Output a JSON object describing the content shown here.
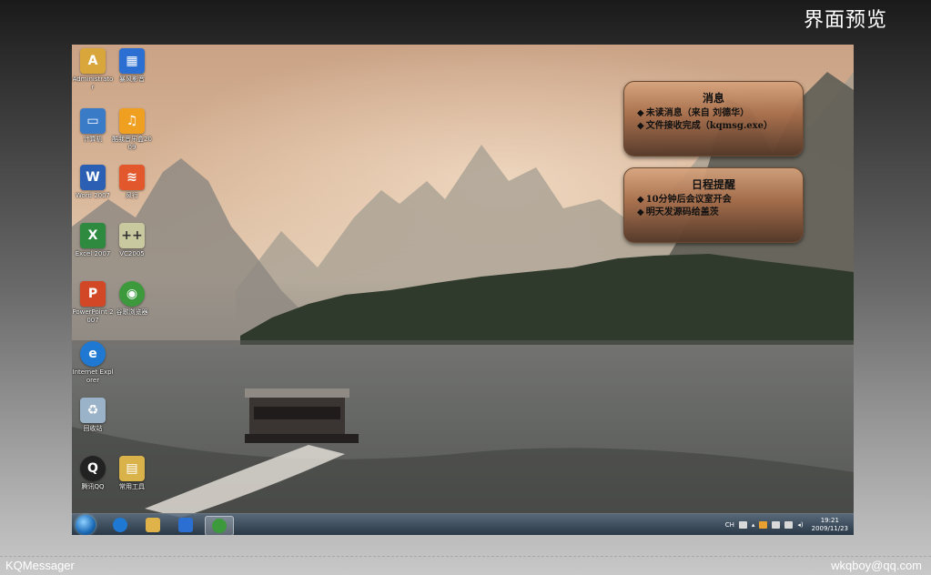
{
  "slide": {
    "title": "界面预览",
    "footer_left": "KQMessager",
    "footer_right": "wkqboy@qq.com"
  },
  "desktop_icons": [
    {
      "label": "Administrator",
      "icon": "user-folder-icon",
      "color": "#d9a63b"
    },
    {
      "label": "暴风影音",
      "icon": "media-player-icon",
      "color": "#2a6fd1"
    },
    {
      "label": "计算机",
      "icon": "computer-icon",
      "color": "#3a7bc8"
    },
    {
      "label": "酷我音乐盒2009",
      "icon": "music-box-icon",
      "color": "#f0a020"
    },
    {
      "label": "Word 2007",
      "icon": "word-icon",
      "color": "#2b5fb3"
    },
    {
      "label": "风行",
      "icon": "funshion-icon",
      "color": "#e2572c"
    },
    {
      "label": "Excel 2007",
      "icon": "excel-icon",
      "color": "#2d8a3e"
    },
    {
      "label": "VC2005",
      "icon": "visual-studio-icon",
      "color": "#c9c9a0"
    },
    {
      "label": "PowerPoint 2007",
      "icon": "powerpoint-icon",
      "color": "#d24726"
    },
    {
      "label": "谷歌浏览器",
      "icon": "chrome-icon",
      "color": "#3c9a3c"
    },
    {
      "label": "Internet Explorer",
      "icon": "ie-icon",
      "color": "#1f78d1"
    },
    {
      "label": "回收站",
      "icon": "recycle-bin-icon",
      "color": "#9ab3c8"
    },
    {
      "label": "腾讯QQ",
      "icon": "qq-penguin-icon",
      "color": "#222222"
    },
    {
      "label": "常用工具",
      "icon": "tools-folder-icon",
      "color": "#d9b24a"
    }
  ],
  "popups": {
    "messages": {
      "title": "消息",
      "lines": [
        "未读消息（来自 刘德华）",
        "文件接收完成（kqmsg.exe）"
      ]
    },
    "reminders": {
      "title": "日程提醒",
      "lines": [
        "10分钟后会议室开会",
        "明天发源码给盖茨"
      ]
    },
    "bullet": "◆"
  },
  "taskbar": {
    "apps": [
      {
        "icon": "ie-icon",
        "color": "#1f78d1"
      },
      {
        "icon": "folder-icon",
        "color": "#e0b34a"
      },
      {
        "icon": "media-player-icon",
        "color": "#2a6fd1"
      },
      {
        "icon": "chrome-icon",
        "color": "#3c9a3c"
      }
    ],
    "tray_text": "CH",
    "time": "19:21",
    "date": "2009/11/23"
  }
}
